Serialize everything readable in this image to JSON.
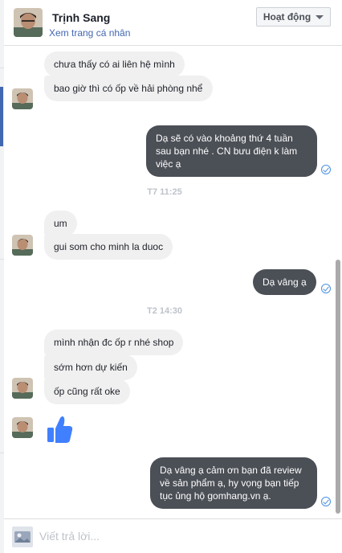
{
  "header": {
    "name": "Trịnh Sang",
    "profile_link": "Xem trang cá nhân",
    "status_button": "Hoạt động"
  },
  "messages": [
    {
      "dir": "in",
      "text": "chưa thấy có ai liên hệ mình"
    },
    {
      "dir": "in",
      "text": "bao giờ thì có ốp về hải phòng nhể"
    },
    {
      "dir": "out",
      "text": "Dạ sẽ có vào khoảng thứ 4 tuần sau bạn nhé . CN bưu điện k làm việc ạ"
    },
    {
      "dir": "divider",
      "text": "T7 11:25"
    },
    {
      "dir": "in",
      "text": "um"
    },
    {
      "dir": "in",
      "text": "gui som cho minh la duoc"
    },
    {
      "dir": "out",
      "text": "Dạ vâng ạ"
    },
    {
      "dir": "divider",
      "text": "T2 14:30"
    },
    {
      "dir": "in",
      "text": "mình nhận đc ốp r nhé shop"
    },
    {
      "dir": "in",
      "text": "sớm hơn dự kiến"
    },
    {
      "dir": "in",
      "text": "ốp cũng rất oke"
    },
    {
      "dir": "in-like",
      "icon": "thumbs-up-icon"
    },
    {
      "dir": "out",
      "text": "Dạ vâng ạ cảm ơn bạn đã review về sản phẩm ạ, hy vọng bạn tiếp tục ủng hộ gomhang.vn ạ."
    }
  ],
  "composer": {
    "placeholder": "Viết trả lời..."
  },
  "colors": {
    "accent": "#4267b2",
    "outgoing_bubble": "#4b4f56",
    "incoming_bubble": "#f1f0f0",
    "like": "#4080ff",
    "seen_check": "#4a90e2"
  }
}
